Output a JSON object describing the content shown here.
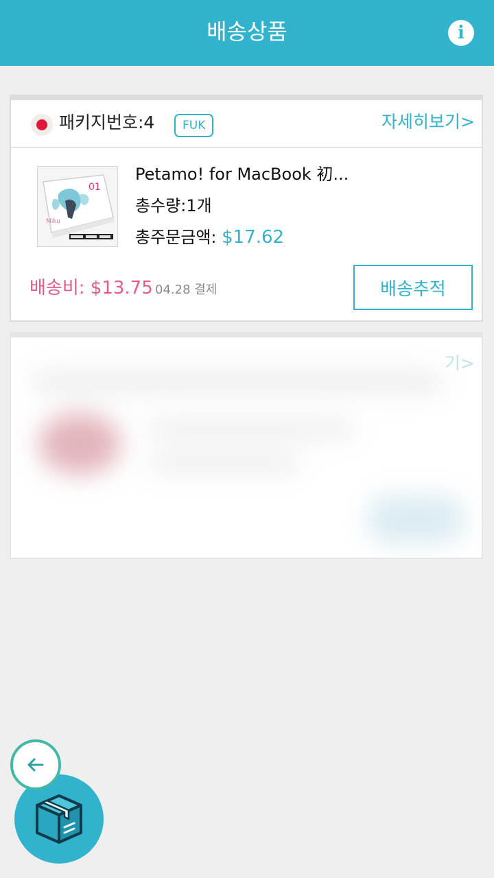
{
  "header": {
    "title": "배송상품",
    "info_icon": "info-icon"
  },
  "package": {
    "flag": "japan-flag-icon",
    "label": "패키지번호:4",
    "code": "FUK",
    "detail_link": "자세히보기>",
    "product_name": "Petamo! for MacBook 初...",
    "quantity": "총수량:1개",
    "total_label": "총주문금액: ",
    "total_amount": "$17.62",
    "shipping_fee": "배송비: $13.75",
    "pay_date": "04.28 결제",
    "track_button": "배송추적"
  },
  "colors": {
    "accent": "#31b2cd",
    "fee": "#e85a84",
    "back_ring": "#42b9a6"
  }
}
